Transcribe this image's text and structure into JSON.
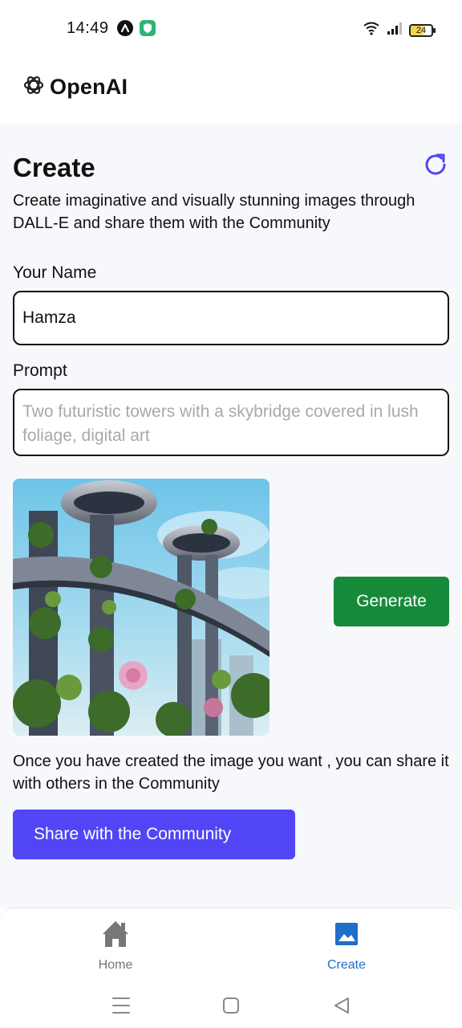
{
  "status_bar": {
    "time": "14:49",
    "battery": "24"
  },
  "header": {
    "logo_text": "OpenAI",
    "logo_icon": "openai-logo-icon"
  },
  "create": {
    "title": "Create",
    "subtitle": "Create imaginative and visually stunning images through DALL-E and share them with the Community",
    "refresh_icon": "refresh-icon",
    "name_label": "Your Name",
    "name_value": "Hamza",
    "prompt_label": "Prompt",
    "prompt_placeholder": "Two futuristic towers with a skybridge covered in lush foliage, digital art",
    "prompt_value": "",
    "generate_label": "Generate",
    "share_note": "Once you have created the image you want , you can share it with others in the Community",
    "share_label": "Share with the Community"
  },
  "bottom_nav": {
    "items": [
      {
        "label": "Home",
        "icon": "home-icon",
        "active": false
      },
      {
        "label": "Create",
        "icon": "image-icon",
        "active": true
      }
    ]
  },
  "colors": {
    "generate": "#178a3a",
    "share": "#5145f6",
    "accent_active": "#1e6fc8",
    "refresh": "#5145f6",
    "page_bg": "#f7f8fc"
  }
}
